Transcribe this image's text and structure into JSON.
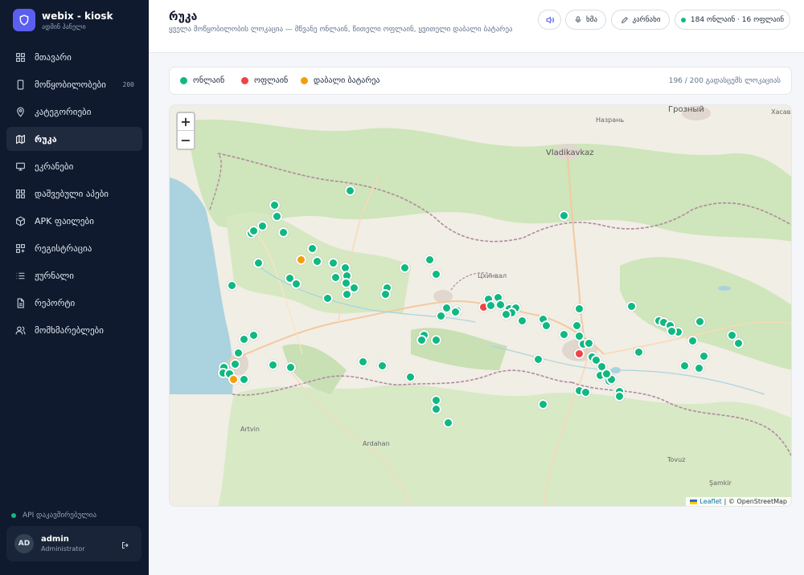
{
  "brand": {
    "title": "webix - kiosk",
    "subtitle": "ადმინ პანელი"
  },
  "nav": [
    {
      "label": "მთავარი",
      "icon": "dashboard-icon",
      "active": false,
      "badge": ""
    },
    {
      "label": "მოწყობილობები",
      "icon": "device-icon",
      "active": false,
      "badge": "200"
    },
    {
      "label": "კატეგორიები",
      "icon": "location-pin-icon",
      "active": false,
      "badge": ""
    },
    {
      "label": "რუკა",
      "icon": "map-icon",
      "active": true,
      "badge": ""
    },
    {
      "label": "ეკრანები",
      "icon": "monitor-icon",
      "active": false,
      "badge": ""
    },
    {
      "label": "დაშვებული აპები",
      "icon": "apps-grid-icon",
      "active": false,
      "badge": ""
    },
    {
      "label": "APK ფაილები",
      "icon": "package-icon",
      "active": false,
      "badge": ""
    },
    {
      "label": "რეგისტრაცია",
      "icon": "register-grid-icon",
      "active": false,
      "badge": ""
    },
    {
      "label": "ჟურნალი",
      "icon": "list-icon",
      "active": false,
      "badge": ""
    },
    {
      "label": "რეპორტი",
      "icon": "report-icon",
      "active": false,
      "badge": ""
    },
    {
      "label": "მომხმარებლები",
      "icon": "users-icon",
      "active": false,
      "badge": ""
    }
  ],
  "api_status": "API დაკავშირებულია",
  "user": {
    "initials": "AD",
    "name": "admin",
    "role": "Administrator"
  },
  "header": {
    "title": "რუკა",
    "subtitle": "ყველა მოწყობილობის ლოკაცია — მწვანე ონლაინ, წითელი ოფლაინ, ყვითელი დაბალი ბატარეა",
    "voice_label": "ხმა",
    "export_label": "კარნახი",
    "status_label": "184 ონლაინ · 16 ოფლაინ"
  },
  "legend": {
    "items": [
      {
        "label": "ონლაინ",
        "color": "#10b981"
      },
      {
        "label": "ოფლაინ",
        "color": "#ef4444"
      },
      {
        "label": "დაბალი ბატარეა",
        "color": "#f59e0b"
      }
    ],
    "count": "196 / 200 გადასცემს ლოკაციას"
  },
  "map": {
    "zoom_in": "+",
    "zoom_out": "−",
    "attribution_leaflet": "Leaflet",
    "attribution_osm": "| © OpenStreetMap",
    "cities": [
      {
        "name": "Грозный",
        "big": true
      },
      {
        "name": "Vladikavkaz",
        "big": true
      },
      {
        "name": "Назрань",
        "big": false
      },
      {
        "name": "Хасавю",
        "big": false
      },
      {
        "name": "Artvin",
        "big": false
      },
      {
        "name": "Ardahan",
        "big": false
      },
      {
        "name": "Tovuz",
        "big": false
      },
      {
        "name": "Şamkir",
        "big": false
      },
      {
        "name": "Цхинвал",
        "big": false
      }
    ],
    "colors": {
      "online": "#10b981",
      "offline": "#ef4444",
      "low": "#f59e0b"
    }
  }
}
